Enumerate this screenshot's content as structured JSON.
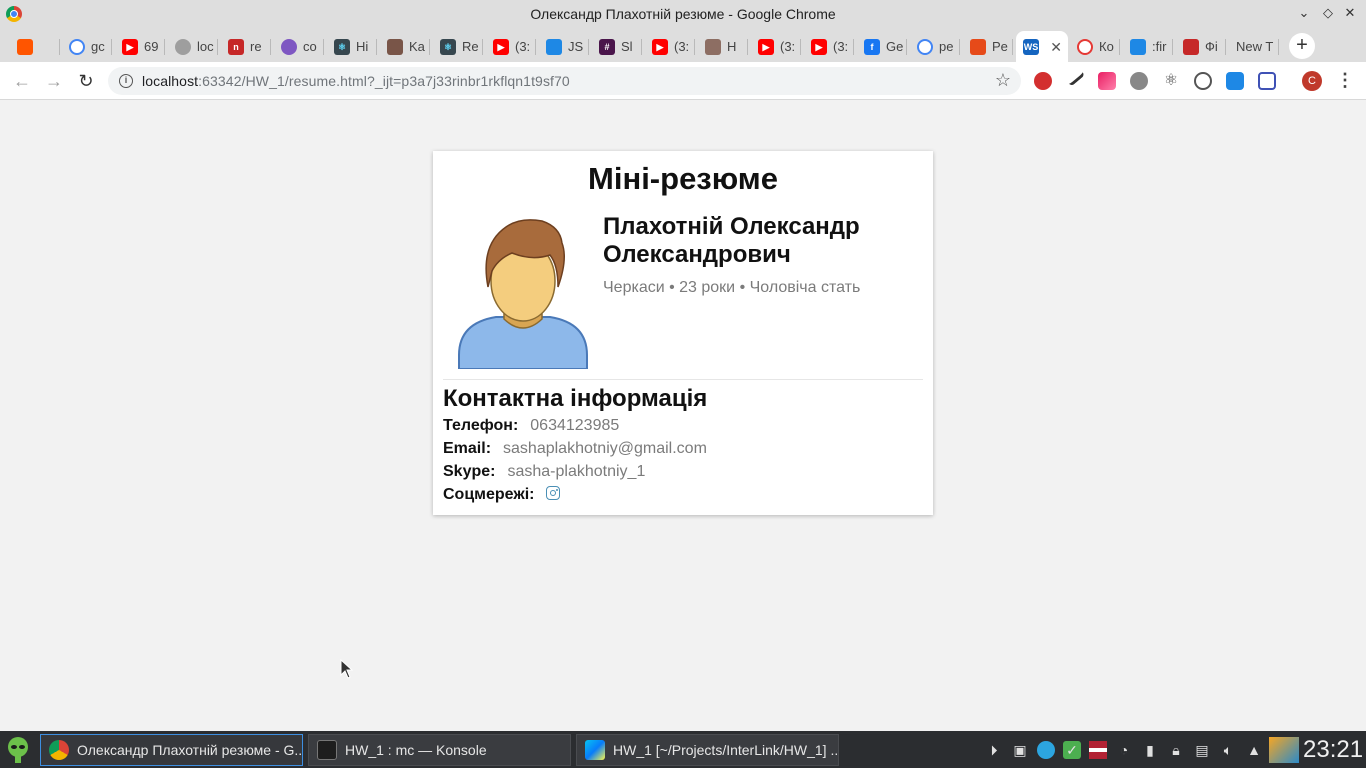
{
  "window": {
    "title": "Олександр Плахотній резюме - Google Chrome"
  },
  "tabs": [
    {
      "label": "",
      "color": "#ff5500"
    },
    {
      "label": "gc",
      "color": "#4285f4"
    },
    {
      "label": "69",
      "color": "#ff0000"
    },
    {
      "label": "loc",
      "color": "#9e9e9e"
    },
    {
      "label": "re",
      "color": "#c62828"
    },
    {
      "label": "co",
      "color": "#7e57c2"
    },
    {
      "label": "Hi",
      "color": "#37474f"
    },
    {
      "label": "Ka",
      "color": "#795548"
    },
    {
      "label": "Re",
      "color": "#37474f"
    },
    {
      "label": "(3:",
      "color": "#ff0000"
    },
    {
      "label": "JS",
      "color": "#1e88e5"
    },
    {
      "label": "Sl",
      "color": "#4a154b"
    },
    {
      "label": "(3:",
      "color": "#ff0000"
    },
    {
      "label": "H",
      "color": "#8d6e63"
    },
    {
      "label": "(3:",
      "color": "#ff0000"
    },
    {
      "label": "(3:",
      "color": "#ff0000"
    },
    {
      "label": "Ge",
      "color": "#1877f2"
    },
    {
      "label": "pe",
      "color": "#4285f4"
    },
    {
      "label": "Pe",
      "color": "#e64a19"
    },
    {
      "label": "",
      "color": "#1565c0"
    },
    {
      "label": "Ко",
      "color": "#e53935"
    },
    {
      "label": ":fir",
      "color": "#1e88e5"
    },
    {
      "label": "Фі",
      "color": "#c62828"
    },
    {
      "label": "New T",
      "color": ""
    }
  ],
  "toolbar": {
    "url_host": "localhost",
    "url_rest": ":63342/HW_1/resume.html?_ijt=p3a7j33rinbr1rkflqn1t9sf70",
    "profile_initial": "C"
  },
  "resume": {
    "title": "Міні-резюме",
    "name": "Плахотній Олександр Олександрович",
    "meta": "Черкаси • 23 роки • Чоловіча стать",
    "contacts_title": "Контактна інформація",
    "phone_label": "Телефон:",
    "phone": "0634123985",
    "email_label": "Email:",
    "email": "sashaplakhotniy@gmail.com",
    "skype_label": "Skype:",
    "skype": "sasha-plakhotniy_1",
    "social_label": "Соцмережі:",
    "social_icon": "instagram-icon"
  },
  "taskbar": {
    "items": [
      "Олександр Плахотній резюме - G...",
      "HW_1 : mc — Konsole",
      "HW_1 [~/Projects/InterLink/HW_1] ..."
    ],
    "clock": "23:21"
  },
  "colors": {
    "accent": "#3d8ee0",
    "instagram": "#4a8fb5"
  }
}
